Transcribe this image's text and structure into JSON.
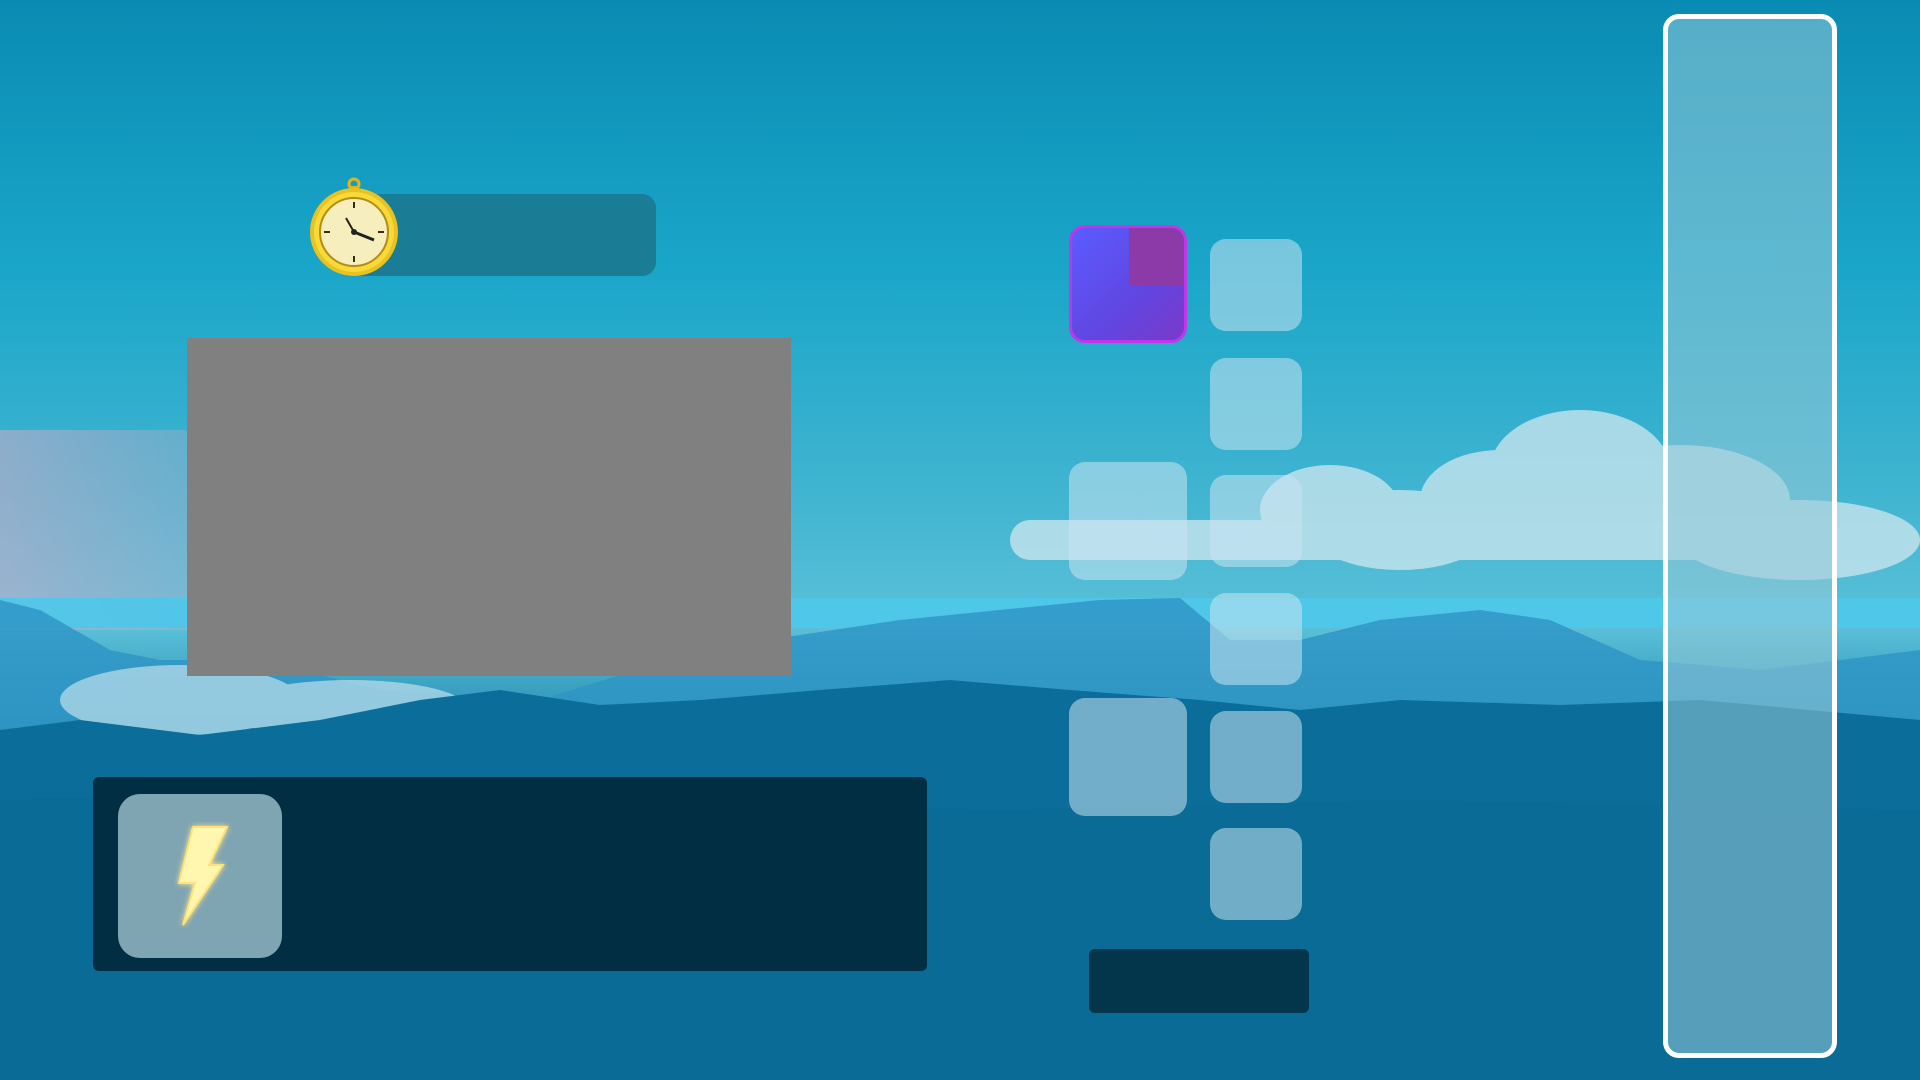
{
  "hud": {
    "timer": {
      "icon": "pocket-watch-icon",
      "label": ""
    },
    "media": {
      "label": ""
    },
    "action": {
      "icon": "lightning-bolt-icon",
      "label": ""
    },
    "confirm": {
      "label": ""
    },
    "meter": {
      "level": 0
    }
  },
  "colors": {
    "accent": "#c235e8",
    "active_slot": "#5a5cff",
    "panel": "#012e42",
    "placeholder": "#808080"
  }
}
